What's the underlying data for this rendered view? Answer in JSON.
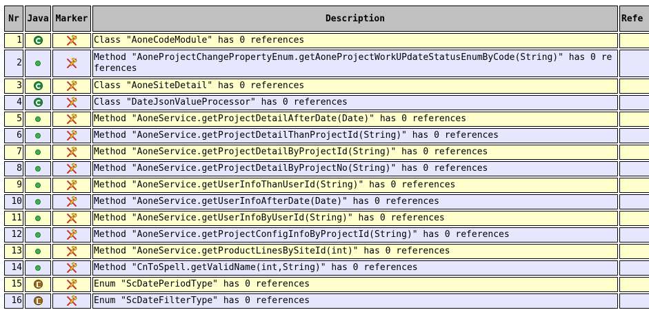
{
  "headers": {
    "nr": "Nr",
    "java": "Java",
    "marker": "Marker",
    "description": "Description",
    "references": "Refe"
  },
  "rows": [
    {
      "nr": "1",
      "kind": "class",
      "description": "Class \"AoneCodeModule\" has 0 references"
    },
    {
      "nr": "2",
      "kind": "method",
      "description": "Method \"AoneProjectChangePropertyEnum.getAoneProjectWorkUPdateStatusEnumByCode(String)\" has 0 references"
    },
    {
      "nr": "3",
      "kind": "class",
      "description": "Class \"AoneSiteDetail\" has 0 references"
    },
    {
      "nr": "4",
      "kind": "class",
      "description": "Class \"DateJsonValueProcessor\" has 0 references"
    },
    {
      "nr": "5",
      "kind": "method",
      "description": "Method \"AoneService.getProjectDetailAfterDate(Date)\" has 0 references"
    },
    {
      "nr": "6",
      "kind": "method",
      "description": "Method \"AoneService.getProjectDetailThanProjectId(String)\" has 0 references"
    },
    {
      "nr": "7",
      "kind": "method",
      "description": "Method \"AoneService.getProjectDetailByProjectId(String)\" has 0 references"
    },
    {
      "nr": "8",
      "kind": "method",
      "description": "Method \"AoneService.getProjectDetailByProjectNo(String)\" has 0 references"
    },
    {
      "nr": "9",
      "kind": "method",
      "description": "Method \"AoneService.getUserInfoThanUserId(String)\" has 0 references"
    },
    {
      "nr": "10",
      "kind": "method",
      "description": "Method \"AoneService.getUserInfoAfterDate(Date)\" has 0 references"
    },
    {
      "nr": "11",
      "kind": "method",
      "description": "Method \"AoneService.getUserInfoByUserId(String)\" has 0 references"
    },
    {
      "nr": "12",
      "kind": "method",
      "description": "Method \"AoneService.getProjectConfigInfoByProjectId(String)\" has 0 references"
    },
    {
      "nr": "13",
      "kind": "method",
      "description": "Method \"AoneService.getProductLinesBySiteId(int)\" has 0 references"
    },
    {
      "nr": "14",
      "kind": "method",
      "description": "Method \"CnToSpell.getValidName(int,String)\" has 0 references"
    },
    {
      "nr": "15",
      "kind": "enum",
      "description": "Enum \"ScDatePeriodType\" has 0 references"
    },
    {
      "nr": "16",
      "kind": "enum",
      "description": "Enum \"ScDateFilterType\" has 0 references"
    }
  ],
  "icons": {
    "class": "class-icon",
    "method": "method-icon",
    "enum": "enum-icon",
    "marker": "unused-code-marker-icon"
  },
  "colors": {
    "row_odd": "#ffffcc",
    "row_even": "#e6e6ff",
    "header": "#c0c0c0"
  }
}
